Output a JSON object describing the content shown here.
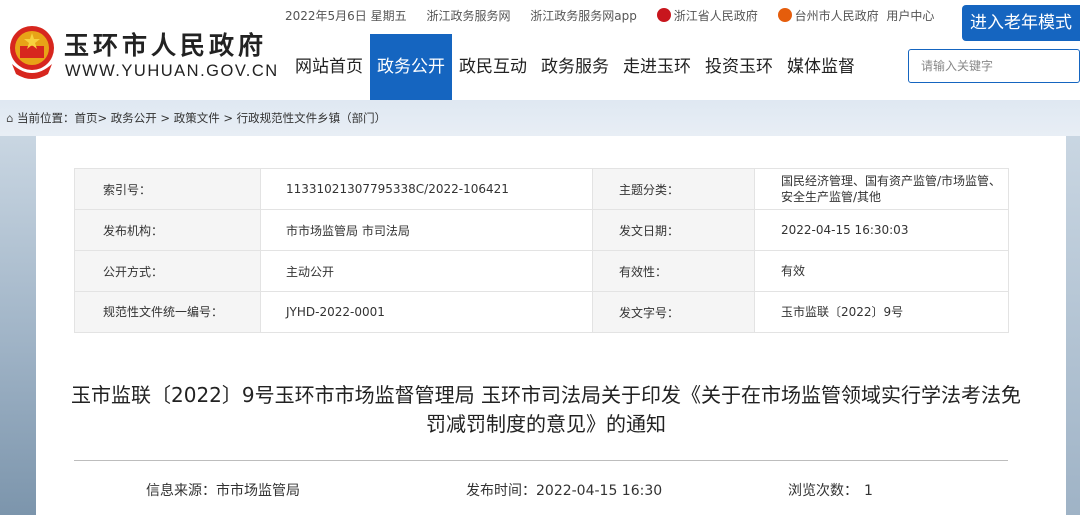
{
  "header": {
    "site_name": "玉环市人民政府",
    "site_domain": "WWW.YUHUAN.GOV.CN",
    "top_links": [
      "2022年5月6日 星期五",
      "浙江政务服务网",
      "浙江政务服务网app",
      "浙江省人民政府",
      "台州市人民政府",
      "用户中心"
    ],
    "elder_mode": "进入老年模式",
    "nav": [
      "网站首页",
      "政务公开",
      "政民互动",
      "政务服务",
      "走进玉环",
      "投资玉环",
      "媒体监督"
    ],
    "active_nav": "政务公开",
    "search_placeholder": "请输入关键字",
    "brand_color": "#1565c0"
  },
  "breadcrumb": {
    "prefix": "当前位置：",
    "path": "首页> 政务公开 > 政策文件 > 行政规范性文件乡镇（部门）"
  },
  "meta": {
    "index_label": "索引号：",
    "index_value": "11331021307795338C/2022-106421",
    "topic_label": "主题分类：",
    "topic_value": "国民经济管理、国有资产监管/市场监管、安全生产监管/其他",
    "org_label": "发布机构：",
    "org_value": "市市场监管局 市司法局",
    "date_label": "发文日期：",
    "date_value": "2022-04-15 16:30:03",
    "open_label": "公开方式：",
    "open_value": "主动公开",
    "valid_label": "有效性：",
    "valid_value": "有效",
    "code_label": "规范性文件统一编号：",
    "code_value": "JYHD-2022-0001",
    "docno_label": "发文字号：",
    "docno_value": "玉市监联〔2022〕9号"
  },
  "document": {
    "title": "玉市监联〔2022〕9号玉环市市场监督管理局 玉环市司法局关于印发《关于在市场监管领域实行学法考法免罚减罚制度的意见》的通知",
    "source_label": "信息来源：",
    "source_value": "市市场监管局",
    "pub_label": "发布时间：",
    "pub_value": "2022-04-15 16:30",
    "views_label": "浏览次数：",
    "views_value": "1"
  }
}
